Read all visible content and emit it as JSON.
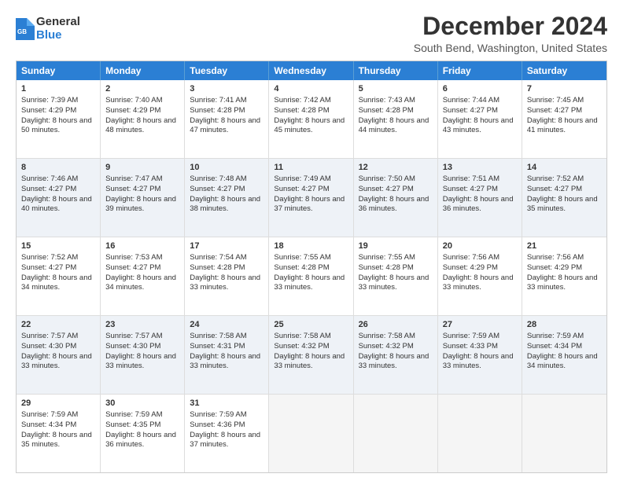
{
  "logo": {
    "general": "General",
    "blue": "Blue"
  },
  "title": "December 2024",
  "location": "South Bend, Washington, United States",
  "days_header": [
    "Sunday",
    "Monday",
    "Tuesday",
    "Wednesday",
    "Thursday",
    "Friday",
    "Saturday"
  ],
  "weeks": [
    [
      {
        "day": "1",
        "sunrise": "Sunrise: 7:39 AM",
        "sunset": "Sunset: 4:29 PM",
        "daylight": "Daylight: 8 hours and 50 minutes."
      },
      {
        "day": "2",
        "sunrise": "Sunrise: 7:40 AM",
        "sunset": "Sunset: 4:29 PM",
        "daylight": "Daylight: 8 hours and 48 minutes."
      },
      {
        "day": "3",
        "sunrise": "Sunrise: 7:41 AM",
        "sunset": "Sunset: 4:28 PM",
        "daylight": "Daylight: 8 hours and 47 minutes."
      },
      {
        "day": "4",
        "sunrise": "Sunrise: 7:42 AM",
        "sunset": "Sunset: 4:28 PM",
        "daylight": "Daylight: 8 hours and 45 minutes."
      },
      {
        "day": "5",
        "sunrise": "Sunrise: 7:43 AM",
        "sunset": "Sunset: 4:28 PM",
        "daylight": "Daylight: 8 hours and 44 minutes."
      },
      {
        "day": "6",
        "sunrise": "Sunrise: 7:44 AM",
        "sunset": "Sunset: 4:27 PM",
        "daylight": "Daylight: 8 hours and 43 minutes."
      },
      {
        "day": "7",
        "sunrise": "Sunrise: 7:45 AM",
        "sunset": "Sunset: 4:27 PM",
        "daylight": "Daylight: 8 hours and 41 minutes."
      }
    ],
    [
      {
        "day": "8",
        "sunrise": "Sunrise: 7:46 AM",
        "sunset": "Sunset: 4:27 PM",
        "daylight": "Daylight: 8 hours and 40 minutes."
      },
      {
        "day": "9",
        "sunrise": "Sunrise: 7:47 AM",
        "sunset": "Sunset: 4:27 PM",
        "daylight": "Daylight: 8 hours and 39 minutes."
      },
      {
        "day": "10",
        "sunrise": "Sunrise: 7:48 AM",
        "sunset": "Sunset: 4:27 PM",
        "daylight": "Daylight: 8 hours and 38 minutes."
      },
      {
        "day": "11",
        "sunrise": "Sunrise: 7:49 AM",
        "sunset": "Sunset: 4:27 PM",
        "daylight": "Daylight: 8 hours and 37 minutes."
      },
      {
        "day": "12",
        "sunrise": "Sunrise: 7:50 AM",
        "sunset": "Sunset: 4:27 PM",
        "daylight": "Daylight: 8 hours and 36 minutes."
      },
      {
        "day": "13",
        "sunrise": "Sunrise: 7:51 AM",
        "sunset": "Sunset: 4:27 PM",
        "daylight": "Daylight: 8 hours and 36 minutes."
      },
      {
        "day": "14",
        "sunrise": "Sunrise: 7:52 AM",
        "sunset": "Sunset: 4:27 PM",
        "daylight": "Daylight: 8 hours and 35 minutes."
      }
    ],
    [
      {
        "day": "15",
        "sunrise": "Sunrise: 7:52 AM",
        "sunset": "Sunset: 4:27 PM",
        "daylight": "Daylight: 8 hours and 34 minutes."
      },
      {
        "day": "16",
        "sunrise": "Sunrise: 7:53 AM",
        "sunset": "Sunset: 4:27 PM",
        "daylight": "Daylight: 8 hours and 34 minutes."
      },
      {
        "day": "17",
        "sunrise": "Sunrise: 7:54 AM",
        "sunset": "Sunset: 4:28 PM",
        "daylight": "Daylight: 8 hours and 33 minutes."
      },
      {
        "day": "18",
        "sunrise": "Sunrise: 7:55 AM",
        "sunset": "Sunset: 4:28 PM",
        "daylight": "Daylight: 8 hours and 33 minutes."
      },
      {
        "day": "19",
        "sunrise": "Sunrise: 7:55 AM",
        "sunset": "Sunset: 4:28 PM",
        "daylight": "Daylight: 8 hours and 33 minutes."
      },
      {
        "day": "20",
        "sunrise": "Sunrise: 7:56 AM",
        "sunset": "Sunset: 4:29 PM",
        "daylight": "Daylight: 8 hours and 33 minutes."
      },
      {
        "day": "21",
        "sunrise": "Sunrise: 7:56 AM",
        "sunset": "Sunset: 4:29 PM",
        "daylight": "Daylight: 8 hours and 33 minutes."
      }
    ],
    [
      {
        "day": "22",
        "sunrise": "Sunrise: 7:57 AM",
        "sunset": "Sunset: 4:30 PM",
        "daylight": "Daylight: 8 hours and 33 minutes."
      },
      {
        "day": "23",
        "sunrise": "Sunrise: 7:57 AM",
        "sunset": "Sunset: 4:30 PM",
        "daylight": "Daylight: 8 hours and 33 minutes."
      },
      {
        "day": "24",
        "sunrise": "Sunrise: 7:58 AM",
        "sunset": "Sunset: 4:31 PM",
        "daylight": "Daylight: 8 hours and 33 minutes."
      },
      {
        "day": "25",
        "sunrise": "Sunrise: 7:58 AM",
        "sunset": "Sunset: 4:32 PM",
        "daylight": "Daylight: 8 hours and 33 minutes."
      },
      {
        "day": "26",
        "sunrise": "Sunrise: 7:58 AM",
        "sunset": "Sunset: 4:32 PM",
        "daylight": "Daylight: 8 hours and 33 minutes."
      },
      {
        "day": "27",
        "sunrise": "Sunrise: 7:59 AM",
        "sunset": "Sunset: 4:33 PM",
        "daylight": "Daylight: 8 hours and 33 minutes."
      },
      {
        "day": "28",
        "sunrise": "Sunrise: 7:59 AM",
        "sunset": "Sunset: 4:34 PM",
        "daylight": "Daylight: 8 hours and 34 minutes."
      }
    ],
    [
      {
        "day": "29",
        "sunrise": "Sunrise: 7:59 AM",
        "sunset": "Sunset: 4:34 PM",
        "daylight": "Daylight: 8 hours and 35 minutes."
      },
      {
        "day": "30",
        "sunrise": "Sunrise: 7:59 AM",
        "sunset": "Sunset: 4:35 PM",
        "daylight": "Daylight: 8 hours and 36 minutes."
      },
      {
        "day": "31",
        "sunrise": "Sunrise: 7:59 AM",
        "sunset": "Sunset: 4:36 PM",
        "daylight": "Daylight: 8 hours and 37 minutes."
      },
      null,
      null,
      null,
      null
    ]
  ]
}
